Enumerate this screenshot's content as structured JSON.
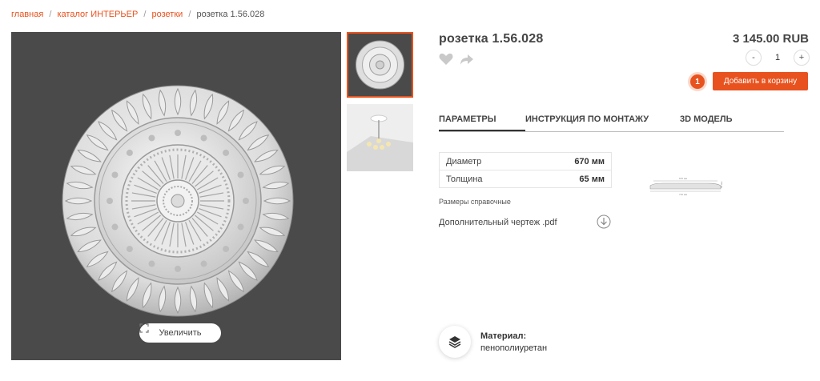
{
  "breadcrumb": {
    "items": [
      "главная",
      "каталог ИНТЕРЬЕР",
      "розетки"
    ],
    "current": "розетка 1.56.028",
    "separator": "/"
  },
  "product": {
    "title": "розетка 1.56.028",
    "price": "3 145.00 RUB",
    "quantity": "1",
    "decrement_label": "-",
    "increment_label": "+",
    "cart_count": "1",
    "add_to_cart_label": "Добавить в корзину",
    "zoom_label": "Увеличить"
  },
  "tabs": [
    {
      "label": "ПАРАМЕТРЫ",
      "active": true
    },
    {
      "label": "ИНСТРУКЦИЯ ПО МОНТАЖУ",
      "active": false
    },
    {
      "label": "3D МОДЕЛЬ",
      "active": false
    }
  ],
  "params": [
    {
      "label": "Диаметр",
      "value": "670 мм"
    },
    {
      "label": "Толщина",
      "value": "65 мм"
    }
  ],
  "drawing": {
    "top_dim": "670 мм",
    "bottom_dim": "710 мм",
    "side_dim": "65 мм"
  },
  "reference_note": "Размеры справочные",
  "pdf_link": "Дополнительный чертеж .pdf",
  "material": {
    "label": "Материал:",
    "value": "пенополиуретан"
  },
  "colors": {
    "accent": "#e8521e",
    "image_bg": "#4a4a4a",
    "text": "#333333"
  },
  "icons": [
    "heart-icon",
    "share-icon",
    "expand-icon",
    "download-icon",
    "layers-icon"
  ]
}
